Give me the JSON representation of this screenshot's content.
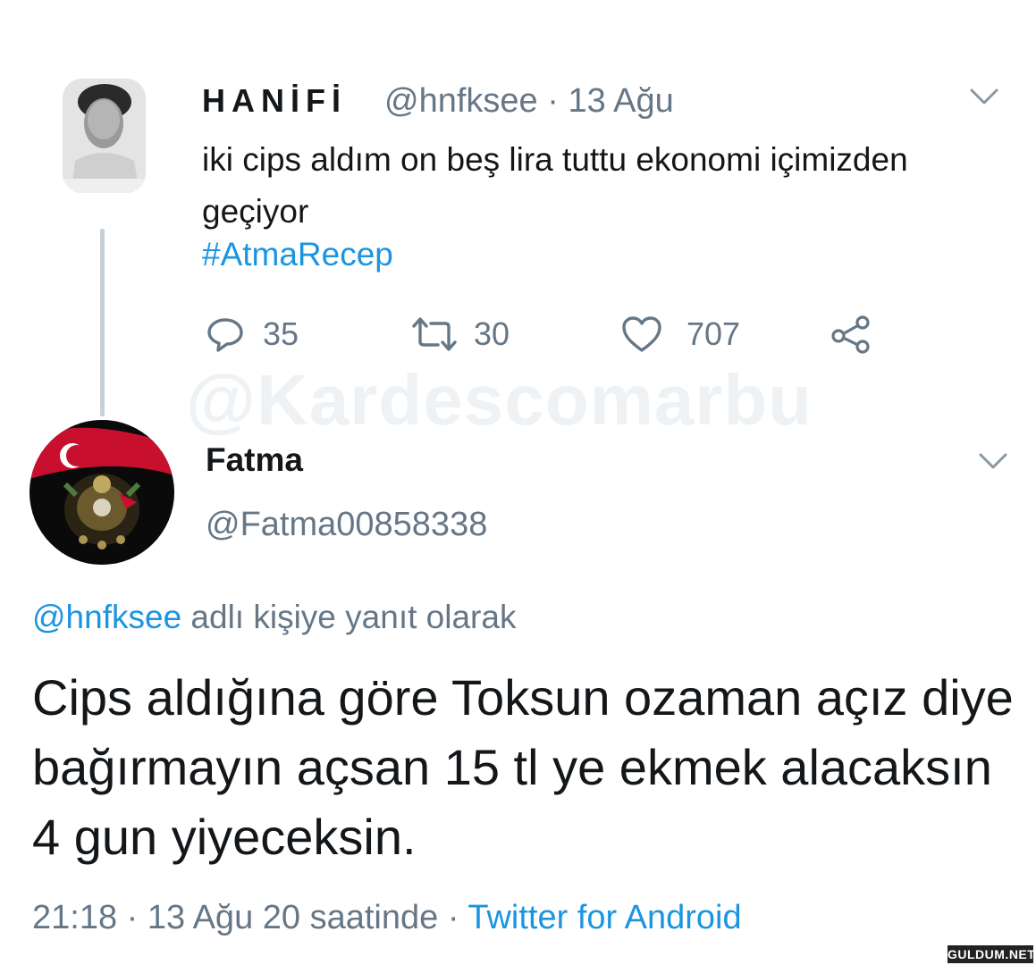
{
  "tweet": {
    "author_name": "HANİFİ",
    "author_handle": "@hnfksee",
    "dot": "·",
    "date": "13 Ağu",
    "text": "iki cips aldım on beş lira tuttu ekonomi içimizden geçiyor",
    "hashtag": "#AtmaRecep",
    "replies": "35",
    "retweets": "30",
    "likes": "707"
  },
  "watermark": "@Kardescomarbu",
  "reply": {
    "author_name": "Fatma",
    "author_handle": "@Fatma00858338",
    "reply_to_mention": "@hnfksee",
    "reply_to_suffix": " adlı kişiye yanıt olarak",
    "text": "Cips aldığına göre Toksun ozaman açız diye bağırmayın açsan 15 tl ye ekmek alacaksın 4 gun yiyeceksin.",
    "timestamp": "21:18 · 13 Ağu 20 saatinde",
    "separator": " · ",
    "source": "Twitter for Android"
  },
  "site_logo": "GULDUM.NET",
  "colors": {
    "link": "#1b95e0",
    "secondary_text": "#657786",
    "primary_text": "#14171a"
  },
  "icons": [
    "reply-icon",
    "retweet-icon",
    "like-icon",
    "share-icon",
    "chevron-down-icon"
  ]
}
